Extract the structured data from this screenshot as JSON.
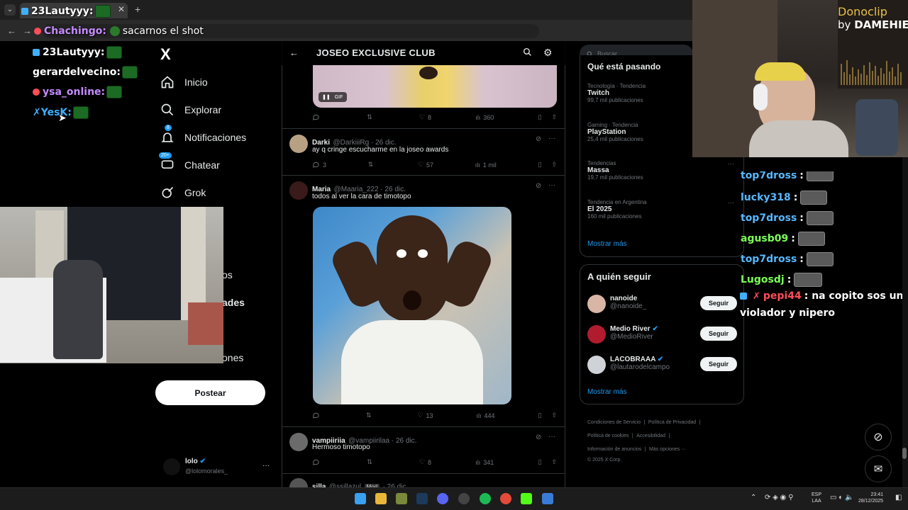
{
  "browser": {
    "tab_title": "23Lautyyy:",
    "address_overlay_user": "Chachingo:",
    "address_overlay_msg": "sacarnos el shot"
  },
  "overlay_chat": {
    "messages": [
      {
        "user": "23Lautyyy:",
        "color": "#ffffff"
      },
      {
        "user": "gerardelvecino:",
        "color": "#ffffff"
      },
      {
        "user": "ysa_online:",
        "color": "#c58bff"
      },
      {
        "user": "YesK:",
        "color": "#3fb0ff"
      }
    ]
  },
  "x_nav": {
    "logo": "X",
    "items": [
      {
        "label": "Inicio",
        "icon": "home-icon"
      },
      {
        "label": "Explorar",
        "icon": "search-icon"
      },
      {
        "label": "Notificaciones",
        "icon": "bell-icon",
        "badge": "8"
      },
      {
        "label": "Chatear",
        "icon": "chat-icon",
        "badge": "20+"
      },
      {
        "label": "Grok",
        "icon": "grok-icon"
      }
    ],
    "hidden_fragments": [
      "os",
      "ades",
      "ones"
    ],
    "post_label": "Postear",
    "account": {
      "name": "lolo",
      "handle": "@lolomorales_",
      "more": "···"
    }
  },
  "center": {
    "title": "JOSEO EXCLUSIVE CLUB",
    "gif_label": "GIF",
    "tweets": [
      {
        "stats": {
          "replies": "",
          "retweets": "",
          "likes": "8",
          "views": "360"
        }
      },
      {
        "name": "Darki",
        "handle": "@DarkiiiRg · 26 dic.",
        "text": "ay q cringe escucharme en la joseo awards",
        "stats": {
          "replies": "3",
          "retweets": "",
          "likes": "57",
          "views": "1 mil"
        }
      },
      {
        "name": "Maria",
        "handle": "@Maaria_222 · 26 dic.",
        "text": "todos al ver la cara de timotopo",
        "stats": {
          "replies": "",
          "retweets": "",
          "likes": "13",
          "views": "444"
        }
      },
      {
        "name": "vampiiriia",
        "handle": "@vampiirilaa · 26 dic.",
        "text": "Hermoso timotopo",
        "stats": {
          "replies": "",
          "retweets": "",
          "likes": "8",
          "views": "341"
        }
      },
      {
        "name": "silla",
        "handle": "@ssillazul",
        "mod": "Mod",
        "date": "· 26 dic."
      }
    ]
  },
  "right": {
    "search_placeholder": "Buscar",
    "trends_title": "Qué está pasando",
    "trends": [
      {
        "cat": "Tecnología · Tendencia",
        "name": "Twitch",
        "count": "99,7 mil publicaciones"
      },
      {
        "cat": "Gaming · Tendencia",
        "name": "PlayStation",
        "count": "25,4 mil publicaciones"
      },
      {
        "cat": "Tendencias",
        "name": "Massa",
        "count": "19,7 mil publicaciones"
      },
      {
        "cat": "Tendencia en Argentina",
        "name": "El 2025",
        "count": "160 mil publicaciones"
      }
    ],
    "show_more": "Mostrar más",
    "who_title": "A quién seguir",
    "who": [
      {
        "name": "nanoide",
        "handle": "@nanoide_",
        "verified": false,
        "btn": "Seguir"
      },
      {
        "name": "Medio River",
        "handle": "@MedioRiver",
        "verified": true,
        "btn": "Seguir"
      },
      {
        "name": "LACOBRAAA",
        "handle": "@lautarodelcampo",
        "verified": true,
        "btn": "Seguir"
      }
    ],
    "show_more2": "Mostrar más",
    "footer": [
      "Condiciones de Servicio",
      "Política de Privacidad",
      "Política de cookies",
      "Accesibilidad",
      "Información de anuncios",
      "Más opciones ···",
      "© 2025 X Corp."
    ]
  },
  "stream_overlay": {
    "donoclip": "Donoclip",
    "by": "by",
    "by_name": "DAMEHIE",
    "chat": [
      {
        "user": "top7dross",
        "color": "#57b8ff"
      },
      {
        "user": "lucky318",
        "color": "#57b8ff"
      },
      {
        "user": "top7dross",
        "color": "#57b8ff"
      },
      {
        "user": "agusb09",
        "color": "#7dff5a"
      },
      {
        "user": "top7dross",
        "color": "#57b8ff"
      },
      {
        "user": "Lugosdj",
        "color": "#7dff5a"
      }
    ],
    "last_user": "pepi44",
    "last_user_color": "#ff4d5a",
    "last_msg_1": ": na copito sos un",
    "last_msg_2": "violador y nipero"
  },
  "taskbar": {
    "lang_1": "ESP",
    "lang_2": "LAA",
    "time": "23:41",
    "date": "28/12/2025"
  }
}
